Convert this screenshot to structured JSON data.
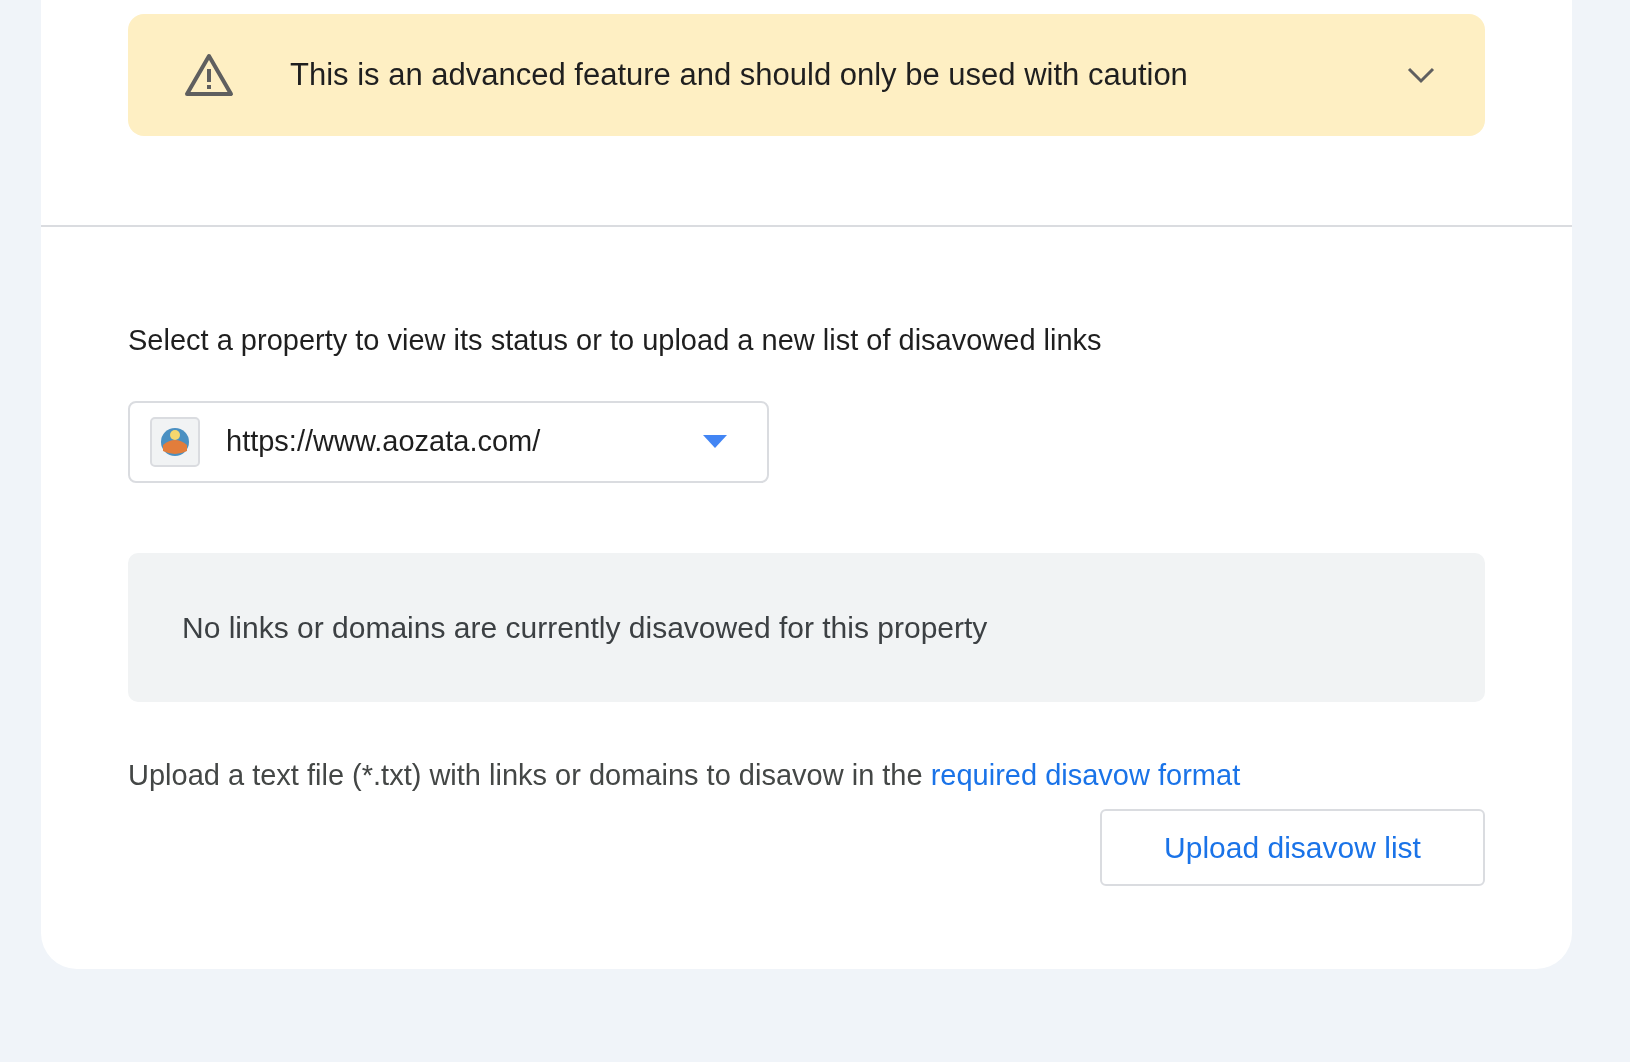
{
  "warning": {
    "text": "This is an advanced feature and should only be used with caution",
    "expanded": false
  },
  "instruction": "Select a property to view its status or to upload a new list of disavowed links",
  "property_select": {
    "value": "https://www.aozata.com/"
  },
  "status_message": "No links or domains are currently disavowed for this property",
  "upload_help": {
    "text": "Upload a text file (*.txt) with links or domains to disavow in the",
    "link_first": "required disavow",
    "link_second": "format"
  },
  "upload_button": "Upload disavow list"
}
